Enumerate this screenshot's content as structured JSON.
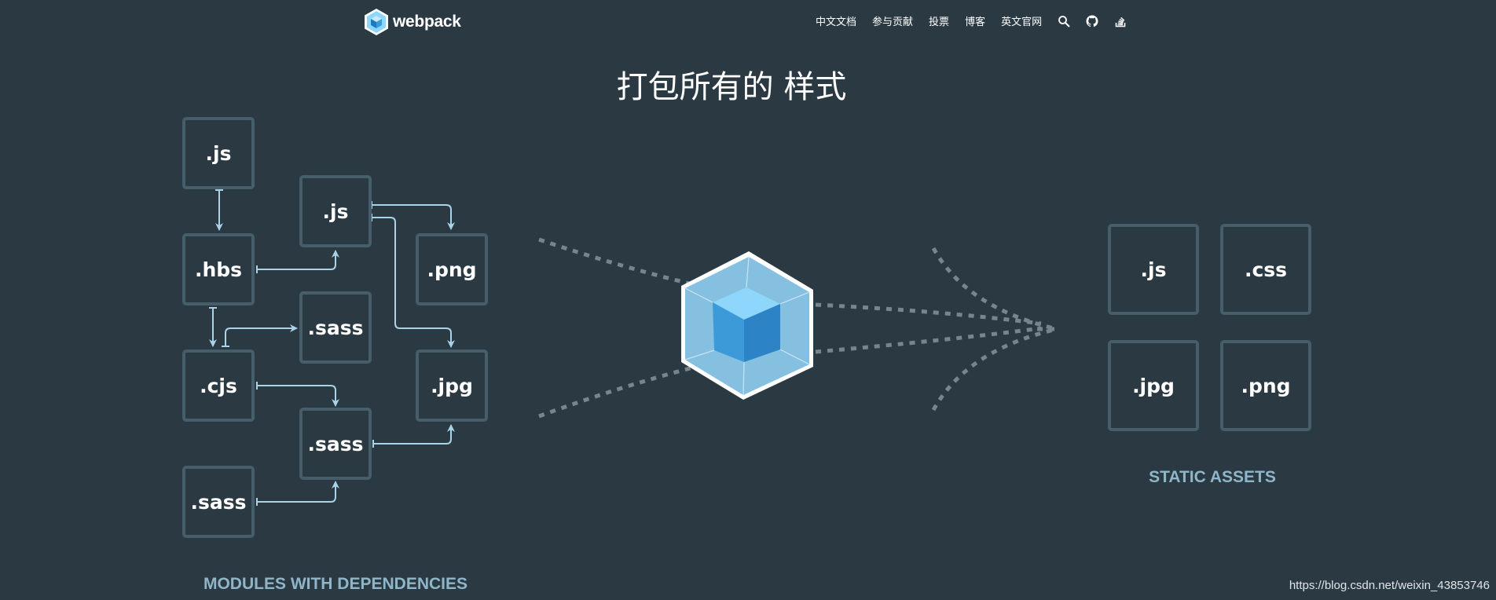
{
  "nav": {
    "logo_text": "webpack",
    "links": [
      {
        "label": "中文文档"
      },
      {
        "label": "参与贡献"
      },
      {
        "label": "投票"
      },
      {
        "label": "博客"
      },
      {
        "label": "英文官网"
      }
    ],
    "icons": [
      "search-icon",
      "github-icon",
      "stack-overflow-icon"
    ]
  },
  "hero": {
    "title": "打包所有的 样式",
    "modules": [
      ".js",
      ".js",
      ".hbs",
      ".png",
      ".sass",
      ".cjs",
      ".jpg",
      ".sass",
      ".sass"
    ],
    "modules_caption": "MODULES WITH DEPENDENCIES",
    "assets": [
      ".js",
      ".css",
      ".jpg",
      ".png"
    ],
    "assets_caption": "STATIC ASSETS"
  },
  "colors": {
    "background": "#2b3a42",
    "box_border": "#465e69",
    "arrow": "#a8d3e9",
    "caption": "#8fb5c9",
    "cube_light": "#8ed6fb",
    "cube_dark": "#1c78c0"
  },
  "watermark": "https://blog.csdn.net/weixin_43853746"
}
